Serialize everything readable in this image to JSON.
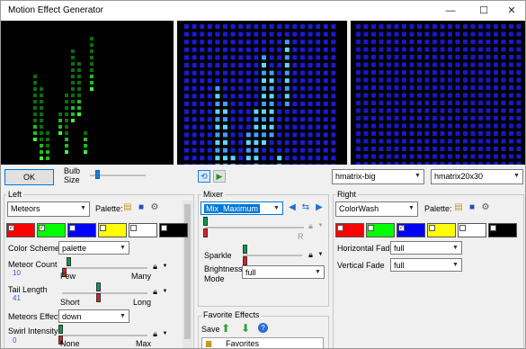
{
  "window": {
    "title": "Motion Effect Generator",
    "minimize": "—",
    "maximize": "☐",
    "close": "✕"
  },
  "toolbar": {
    "ok_label": "OK",
    "bulb_size_label": "Bulb\nSize",
    "model_select": "hmatrix-big",
    "matrix_select": "hmatrix20x30",
    "bulb_size_level": 0.1
  },
  "left": {
    "group_label": "Left",
    "effect": "Meteors",
    "palette_label": "Palette:",
    "colors": [
      {
        "hex": "#ff0000",
        "checked": true
      },
      {
        "hex": "#00ff00",
        "checked": true
      },
      {
        "hex": "#0000ff",
        "checked": false
      },
      {
        "hex": "#ffff00",
        "checked": false
      },
      {
        "hex": "#ffffff",
        "checked": false
      },
      {
        "hex": "#000000",
        "checked": false
      }
    ],
    "color_scheme_label": "Color Scheme",
    "color_scheme_value": "palette",
    "meteor_count_label": "Meteor Count",
    "meteor_count_value": "10",
    "meteor_count_min": "Few",
    "meteor_count_max": "Many",
    "tail_length_label": "Tail Length",
    "tail_length_value": "41",
    "tail_length_min": "Short",
    "tail_length_max": "Long",
    "meteors_effect_label": "Meteors Effect",
    "meteors_effect_value": "down",
    "swirl_intensity_label": "Swirl Intensity",
    "swirl_intensity_value": "0",
    "swirl_min": "None",
    "swirl_max": "Max"
  },
  "mixer": {
    "group_label": "Mixer",
    "mix_value": "Mix_Maximum",
    "r_label": "R",
    "sparkle_label": "Sparkle",
    "brightness_mode_label": "Brightness\nMode",
    "brightness_mode_value": "full"
  },
  "favorites": {
    "group_label": "Favorite Effects",
    "save_label": "Save",
    "item": "Favorites"
  },
  "right": {
    "group_label": "Right",
    "effect": "ColorWash",
    "palette_label": "Palette:",
    "colors": [
      {
        "hex": "#ff0000",
        "checked": false
      },
      {
        "hex": "#00ff00",
        "checked": false
      },
      {
        "hex": "#0000ff",
        "checked": true
      },
      {
        "hex": "#ffff00",
        "checked": false
      },
      {
        "hex": "#ffffff",
        "checked": false
      },
      {
        "hex": "#000000",
        "checked": false
      }
    ],
    "horizontal_fade_label": "Horizontal Fade",
    "horizontal_fade_value": "full",
    "vertical_fade_label": "Vertical Fade",
    "vertical_fade_value": "full"
  }
}
